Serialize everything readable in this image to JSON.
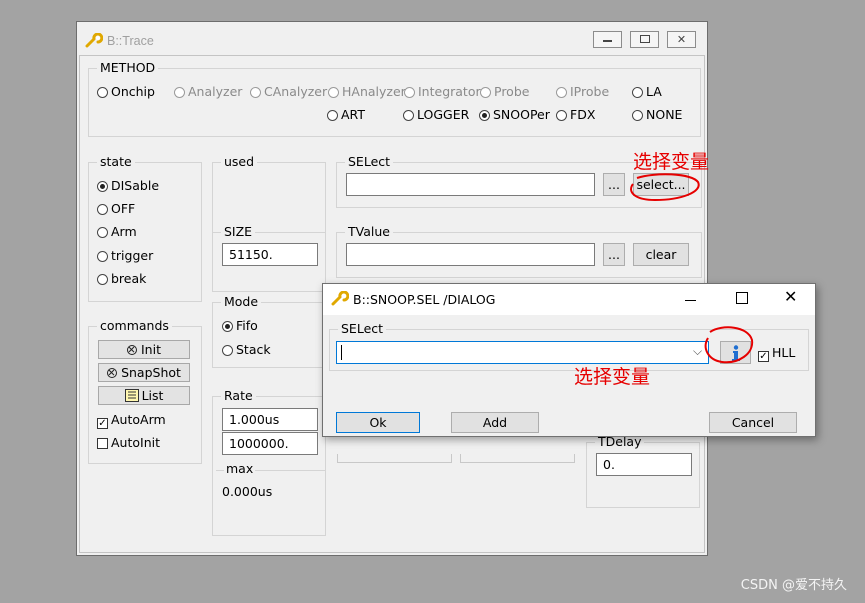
{
  "main_window": {
    "title": "B::Trace",
    "titlebar_buttons": [
      "minimize",
      "maximize",
      "close"
    ]
  },
  "method": {
    "label": "METHOD",
    "options": [
      {
        "label": "Onchip",
        "enabled": true,
        "selected": false
      },
      {
        "label": "Analyzer",
        "enabled": false,
        "selected": false
      },
      {
        "label": "CAnalyzer",
        "enabled": false,
        "selected": false
      },
      {
        "label": "HAnalyzer",
        "enabled": false,
        "selected": false
      },
      {
        "label": "Integrator",
        "enabled": false,
        "selected": false
      },
      {
        "label": "Probe",
        "enabled": false,
        "selected": false
      },
      {
        "label": "IProbe",
        "enabled": false,
        "selected": false
      },
      {
        "label": "LA",
        "enabled": true,
        "selected": false
      },
      {
        "label": "ART",
        "enabled": true,
        "selected": false
      },
      {
        "label": "LOGGER",
        "enabled": true,
        "selected": false
      },
      {
        "label": "SNOOPer",
        "enabled": true,
        "selected": true
      },
      {
        "label": "FDX",
        "enabled": true,
        "selected": false
      },
      {
        "label": "NONE",
        "enabled": true,
        "selected": false
      }
    ]
  },
  "state": {
    "label": "state",
    "options": [
      {
        "label": "DISable",
        "selected": true
      },
      {
        "label": "OFF",
        "selected": false
      },
      {
        "label": "Arm",
        "selected": false
      },
      {
        "label": "trigger",
        "selected": false
      },
      {
        "label": "break",
        "selected": false
      }
    ]
  },
  "used": {
    "label": "used"
  },
  "size": {
    "label": "SIZE",
    "value": "51150."
  },
  "select_group": {
    "label": "SELect",
    "value": "",
    "browse_label": "...",
    "select_label": "select..."
  },
  "tvalue_group": {
    "label": "TValue",
    "value": "",
    "browse_label": "...",
    "clear_label": "clear"
  },
  "mode": {
    "label": "Mode",
    "options": [
      {
        "label": "Fifo",
        "selected": true
      },
      {
        "label": "Stack",
        "selected": false
      }
    ]
  },
  "commands": {
    "label": "commands",
    "init_label": "Init",
    "snapshot_label": "SnapShot",
    "list_label": "List",
    "autoarm_label": "AutoArm",
    "autoarm_checked": true,
    "autoinit_label": "AutoInit",
    "autoinit_checked": false
  },
  "rate": {
    "label": "Rate",
    "value1": "1.000us",
    "value2": "1000000.",
    "max_label": "max",
    "max_value": "0.000us"
  },
  "tdelay": {
    "label": "TDelay",
    "value": "0."
  },
  "dialog": {
    "title": "B::SNOOP.SEL /DIALOG",
    "select_label": "SELect",
    "input_value": "",
    "hll_label": "HLL",
    "hll_checked": true,
    "ok_label": "Ok",
    "add_label": "Add",
    "cancel_label": "Cancel"
  },
  "annotations": {
    "top_note": "选择变量",
    "dialog_note": "选择变量",
    "color": "#e60000"
  },
  "watermark": "CSDN @爱不持久"
}
